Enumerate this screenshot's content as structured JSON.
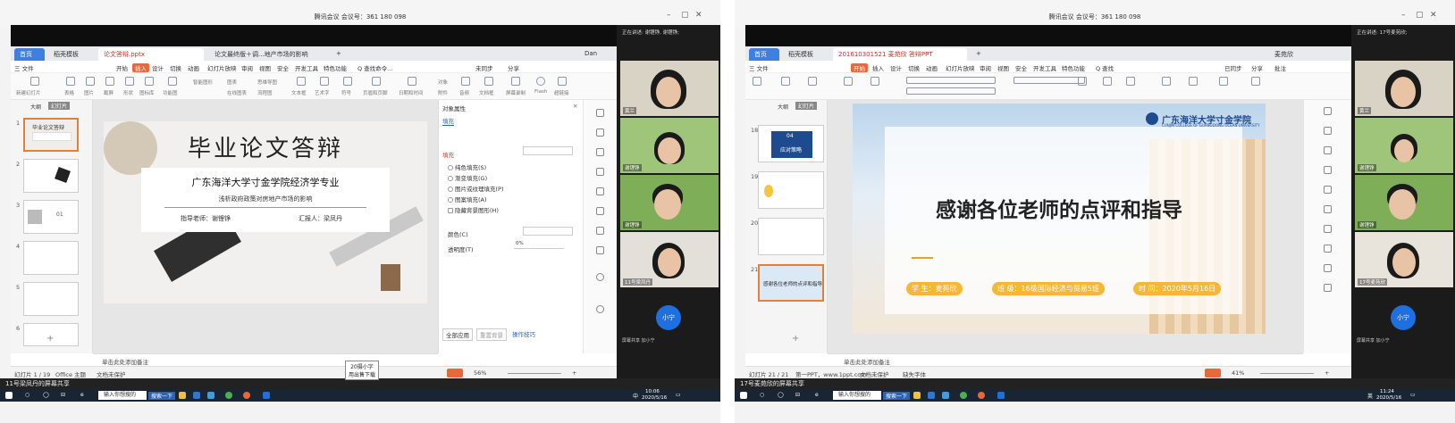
{
  "left": {
    "window_title": "腾讯会议 会议号：361 180 098",
    "tabs": [
      "首页",
      "稻壳模板",
      "论文答辩.pptx",
      "论文最终版＋调...地产市场的影响"
    ],
    "user_badge": "Dan",
    "menu": [
      "三 文件",
      "开始",
      "插入",
      "设计",
      "切换",
      "动画",
      "幻灯片放映",
      "审阅",
      "视图",
      "安全",
      "开发工具",
      "特色功能",
      "Q 查找命令..."
    ],
    "menu_right": [
      "未同步",
      "分享"
    ],
    "ribbon_labels": [
      "新建幻灯片",
      "表格",
      "图片",
      "截屏",
      "形状",
      "图标库",
      "功能图",
      "智能图形",
      "图表",
      "在线图表",
      "思维导图",
      "流程图",
      "文本框",
      "艺术字",
      "符号",
      "页眉和页脚",
      "日期和时间",
      "对象",
      "附件",
      "音频",
      "文档框",
      "文档图库",
      "屏幕录制",
      "Flash",
      "超链接"
    ],
    "thumb_tabs": [
      "大纲",
      "幻灯片"
    ],
    "thumb_numbers": [
      "1",
      "2",
      "3",
      "4",
      "5",
      "6"
    ],
    "thumb1_title": "毕业论文答辩",
    "thumb3_num": "01",
    "slide": {
      "title": "毕业论文答辩",
      "school": "广东海洋大学寸金学院经济学专业",
      "subtitle": "浅析政府政策对房地产市场的影响",
      "advisor": "指导老师：谢锂铮",
      "presenter": "汇报人：梁凤丹"
    },
    "props": {
      "header": "对象属性",
      "tab": "填充",
      "fill_section": "填充",
      "options": [
        "纯色填充(S)",
        "渐变填充(G)",
        "图片或纹理填充(P)",
        "图案填充(A)",
        "隐藏背景图形(H)"
      ],
      "color_label": "颜色(C)",
      "transparency_label": "透明度(T)",
      "transparency_value": "0%",
      "apply_all": "全部应用",
      "reset": "重置背景",
      "tips": "操作技巧"
    },
    "notes": "单击此处添加备注",
    "status": {
      "slide_count": "幻灯片 1 / 19",
      "theme": "Office 主题",
      "protect": "文档未保护",
      "zoom": "56%"
    },
    "videos": [
      {
        "name": "黄兰"
      },
      {
        "name": "谢锂铮"
      },
      {
        "name": "谢锂铮"
      },
      {
        "name": "11号梁凤丹"
      }
    ],
    "top_caption": "正在讲述: 谢锂铮, 谢锂铮;",
    "avatar_label": "小宁",
    "avatar_caption": "屏幕共享 加小宁",
    "share_caption": "11号梁凤丹的屏幕共享",
    "popup": [
      "20摄小字",
      "用出售下载"
    ],
    "taskbar": {
      "search_placeholder": "输入你想搜的",
      "search_button": "搜索一下",
      "time": "10:06",
      "date": "2020/5/16",
      "ime": "中"
    }
  },
  "right": {
    "window_title": "腾讯会议 会议号：361 180 098",
    "tabs": [
      "首页",
      "稻壳模板",
      "201610301521 麦苑欣 答辩PPT"
    ],
    "user_badge": "麦苑欣",
    "menu": [
      "三 文件",
      "开始",
      "插入",
      "设计",
      "切换",
      "动画",
      "幻灯片放映",
      "审阅",
      "视图",
      "安全",
      "开发工具",
      "特色功能",
      "Q 查找"
    ],
    "menu_right": [
      "已同步",
      "分享",
      "批注"
    ],
    "thumb_tabs": [
      "大纲",
      "幻灯片"
    ],
    "thumb_numbers": [
      "18",
      "19",
      "20",
      "21"
    ],
    "thumb18_text": "应对策略",
    "thumb18_num": "04",
    "thumb21_text": "感谢各位老师的点评和指导",
    "slide": {
      "logo_text": "广东海洋大学寸金学院",
      "logo_sub": "CUNJIN COLLEGE OF GUANGDONG OCEAN UNIVERSITY",
      "main": "感谢各位老师的点评和指导",
      "student": "学  生：麦苑欣",
      "class": "班  级：16级国际经济与贸易5班",
      "date": "时  间：2020年5月16日"
    },
    "notes": "单击此处添加备注",
    "status": {
      "slide_count": "幻灯片 21 / 21",
      "theme": "第一PPT，www.1ppt.com",
      "protect": "文档未保护",
      "spell": "缺失字体",
      "zoom": "41%"
    },
    "videos": [
      {
        "name": "黄兰"
      },
      {
        "name": "谢锂铮"
      },
      {
        "name": "谢锂铮"
      },
      {
        "name": "17号麦苑欣"
      }
    ],
    "top_caption": "正在讲述: 17号麦苑欣;",
    "avatar_label": "小宁",
    "avatar_caption": "屏幕共享 加小宁",
    "share_caption": "17号麦苑欣的屏幕共享",
    "taskbar": {
      "search_placeholder": "输入你想搜的",
      "search_button": "搜索一下",
      "time": "11:24",
      "date": "2020/5/16",
      "ime": "英"
    }
  },
  "colors": {
    "accent_orange": "#e9673a",
    "wps_blue": "#3e7fe0",
    "title_ribbon": "#f6b734",
    "avatar_blue": "#1e6fe0"
  }
}
